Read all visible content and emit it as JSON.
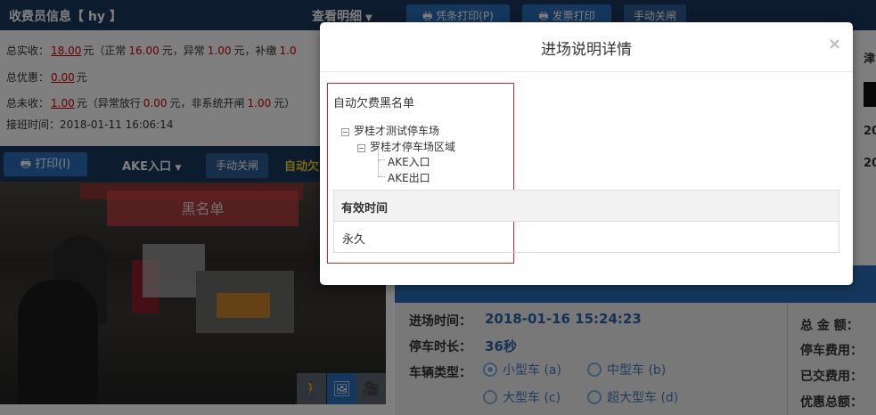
{
  "left_header": {
    "title": "收费员信息【 hy 】",
    "detail_link": "查看明细"
  },
  "money": {
    "line1_prefix": "总实收：",
    "total_received": "18.00",
    "yuan": "元",
    "paren_open": "（正常",
    "normal": "16.00",
    "abnormal_label": "元，异常",
    "abnormal": "1.00",
    "supplement_label": "元，补缴",
    "supplement": "1.0",
    "line2_prefix": "总优惠：",
    "total_discount": "0.00",
    "line3_prefix": "总未收：",
    "total_unpaid": "1.00",
    "line3_paren": "（异常放行",
    "abnormal_release": "0.00",
    "line3_mid": "元，非系统开闸",
    "non_system_open": "1.00",
    "line3_end": "元）",
    "shift_label": "接班时间：",
    "shift_time": "2018-01-11 16:06:14"
  },
  "cam_toolbar": {
    "print": "打印(I)",
    "lane": "AKE入口",
    "manual_close": "手动关闸",
    "auto_text": "自动欠"
  },
  "camera": {
    "overlay_label": "黑名单"
  },
  "top_right": {
    "voucher_print": "凭条打印(P)",
    "invoice_print": "发票打印",
    "manual_close": "手动关闸"
  },
  "right_col": {
    "r1": "津",
    "r2": "20",
    "r3": "20"
  },
  "details": {
    "entry_time_label": "进场时间：",
    "entry_time": "2018-01-16 15:24:23",
    "duration_label": "停车时长：",
    "duration": "36秒",
    "vehicle_type_label": "车辆类型：",
    "types": [
      "小型车 (a)",
      "中型车 (b)",
      "大型车 (c)",
      "超大型车 (d)"
    ],
    "total_amount": "总 金 额：",
    "parking_fee": "停车费用：",
    "paid_fee": "已交费用：",
    "discount_total": "优惠总额："
  },
  "modal": {
    "title": "进场说明详情",
    "close": "×",
    "group_title": "自动欠费黑名单",
    "tree": {
      "root": "罗桂才测试停车场",
      "area": "罗桂才停车场区域",
      "leaves": [
        "AKE入口",
        "AKE出口"
      ]
    },
    "table": {
      "header": "有效时间",
      "value": "永久"
    }
  }
}
